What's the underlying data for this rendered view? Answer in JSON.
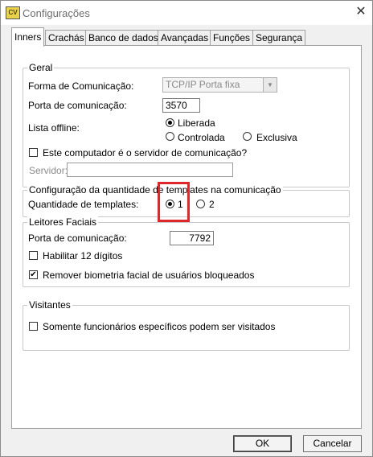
{
  "window": {
    "title": "Configurações",
    "close_glyph": "✕"
  },
  "tabs": [
    {
      "label": "Inners",
      "active": true
    },
    {
      "label": "Crachás"
    },
    {
      "label": "Banco de dados"
    },
    {
      "label": "Avançadas"
    },
    {
      "label": "Funções"
    },
    {
      "label": "Segurança"
    }
  ],
  "geral": {
    "title": "Geral",
    "comm_form_label": "Forma de Comunicação:",
    "comm_form_value": "TCP/IP Porta fixa",
    "port_label": "Porta de comunicação:",
    "port_value": "3570",
    "offline_label": "Lista offline:",
    "offline_options": [
      "Liberada",
      "Controlada",
      "Exclusiva"
    ],
    "offline_selected": "Liberada",
    "server_check_label": "Este computador é o servidor de comunicação?",
    "server_checked": false,
    "server_label": "Servidor:",
    "server_value": ""
  },
  "templates": {
    "title": "Configuração da quantidade de templates na comunicação",
    "qty_label": "Quantidade de templates:",
    "options": [
      "1",
      "2"
    ],
    "selected": "1"
  },
  "facial": {
    "title": "Leitores Faciais",
    "port_label": "Porta de comunicação:",
    "port_value": "7792",
    "twelve_digits_label": "Habilitar 12 dígitos",
    "twelve_digits_checked": false,
    "remove_bio_label": "Remover biometria facial de usuários bloqueados",
    "remove_bio_checked": true
  },
  "visitors": {
    "title": "Visitantes",
    "specific_label": "Somente funcionários específicos podem ser visitados",
    "specific_checked": false
  },
  "buttons": {
    "ok": "OK",
    "cancel": "Cancelar"
  },
  "colors": {
    "highlight": "#e0262b"
  },
  "glyphs": {
    "check": "✔",
    "dropdown": "▼",
    "app_icon": "CV"
  }
}
